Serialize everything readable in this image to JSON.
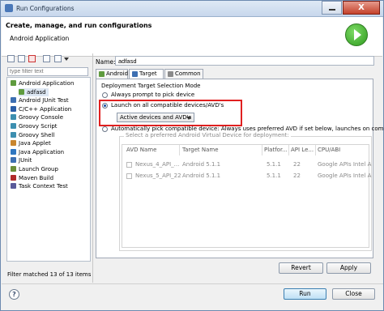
{
  "window": {
    "title": "Run Configurations",
    "close_glyph": "X"
  },
  "header": {
    "title": "Create, manage, and run configurations",
    "subtitle": "Android Application"
  },
  "filter": {
    "placeholder": "type filter text"
  },
  "tree": {
    "items": [
      {
        "label": "Android Application",
        "indent": 0,
        "icon": "android-app-icon",
        "color": "#5f9b3e"
      },
      {
        "label": "adfasd",
        "indent": 1,
        "icon": "android-config-icon",
        "color": "#5f9b3e",
        "selected": true
      },
      {
        "label": "Android JUnit Test",
        "indent": 0,
        "icon": "junit-icon",
        "color": "#3d6fb2"
      },
      {
        "label": "C/C++ Application",
        "indent": 0,
        "icon": "c-app-icon",
        "color": "#2b5fa8"
      },
      {
        "label": "Groovy Console",
        "indent": 0,
        "icon": "groovy-icon",
        "color": "#3d8fb0"
      },
      {
        "label": "Groovy Script",
        "indent": 0,
        "icon": "groovy-icon",
        "color": "#3d8fb0"
      },
      {
        "label": "Groovy Shell",
        "indent": 0,
        "icon": "groovy-icon",
        "color": "#3d8fb0"
      },
      {
        "label": "Java Applet",
        "indent": 0,
        "icon": "java-applet-icon",
        "color": "#c9862e"
      },
      {
        "label": "Java Application",
        "indent": 0,
        "icon": "java-app-icon",
        "color": "#2f76c0"
      },
      {
        "label": "JUnit",
        "indent": 0,
        "icon": "junit-icon",
        "color": "#3d6fb2"
      },
      {
        "label": "Launch Group",
        "indent": 0,
        "icon": "launch-group-icon",
        "color": "#6b8e3a"
      },
      {
        "label": "Maven Build",
        "indent": 0,
        "icon": "maven-icon",
        "color": "#b02a2a"
      },
      {
        "label": "Task Context Test",
        "indent": 0,
        "icon": "task-icon",
        "color": "#5a5a9a"
      }
    ]
  },
  "filter_status": "Filter matched 13 of 13 items",
  "name": {
    "label": "Name:",
    "value": "adfasd"
  },
  "tabs": [
    {
      "label": "Android",
      "icon": "android-tab-icon",
      "color": "#5f9b3e"
    },
    {
      "label": "Target",
      "icon": "target-tab-icon",
      "color": "#3d6fb2",
      "active": true
    },
    {
      "label": "Common",
      "icon": "common-tab-icon",
      "color": "#8a8a8a"
    }
  ],
  "target": {
    "group_label": "Deployment Target Selection Mode",
    "opt_prompt": "Always prompt to pick device",
    "opt_launch": "Launch on all compatible devices/AVD's",
    "dropdown_value": "Active devices and AVD's",
    "opt_auto": "Automatically pick compatible device: Always uses preferred AVD if set below, launches on compati",
    "avd_group_label": "Select a preferred Android Virtual Device for deployment:",
    "columns": [
      "AVD Name",
      "Target Name",
      "Platfor...",
      "API Le...",
      "CPU/ABI"
    ],
    "rows": [
      [
        "Nexus_4_API_...",
        "Android 5.1.1",
        "5.1.1",
        "22",
        "Google APIs Intel A"
      ],
      [
        "Nexus_5_API_22",
        "Android 5.1.1",
        "5.1.1",
        "22",
        "Google APIs Intel A"
      ]
    ]
  },
  "buttons": {
    "revert": "Revert",
    "apply": "Apply",
    "run": "Run",
    "close": "Close",
    "help": "?"
  }
}
